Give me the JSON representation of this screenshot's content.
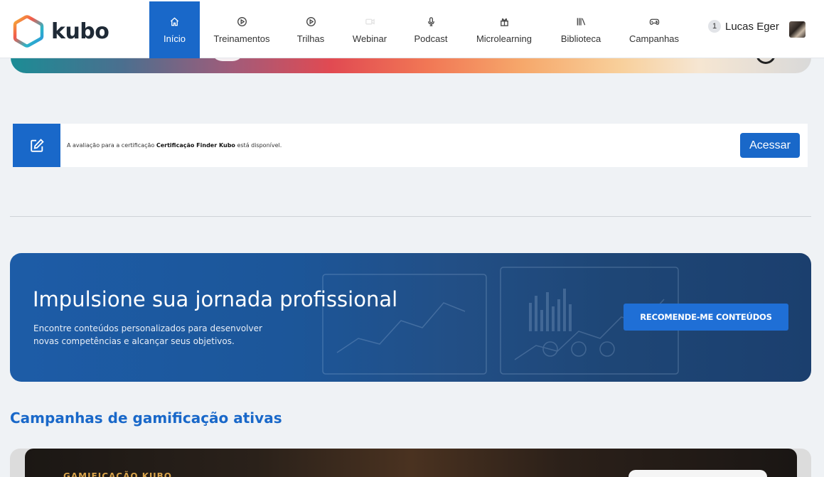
{
  "app": {
    "logo_text": "kubo",
    "accent": "#1968c9"
  },
  "nav": [
    {
      "label": "Início",
      "icon": "home-icon",
      "active": true
    },
    {
      "label": "Treinamentos",
      "icon": "play-circle-icon"
    },
    {
      "label": "Trilhas",
      "icon": "play-circle-icon"
    },
    {
      "label": "Webinar",
      "icon": "video-icon"
    },
    {
      "label": "Podcast",
      "icon": "microphone-icon"
    },
    {
      "label": "Microlearning",
      "icon": "gift-icon"
    },
    {
      "label": "Biblioteca",
      "icon": "books-icon"
    },
    {
      "label": "Campanhas",
      "icon": "gamepad-icon"
    }
  ],
  "user": {
    "notification_count": "1",
    "name": "Lucas Eger"
  },
  "notice": {
    "text_prefix": "A avaliação para a certificação ",
    "certification": "Certificação Finder Kubo",
    "text_suffix": " está disponível.",
    "button": "Acessar"
  },
  "hero": {
    "title": "Impulsione sua jornada profissional",
    "subtitle": "Encontre conteúdos personalizados para desenvolver novas competências e alcançar seus objetivos.",
    "button": "RECOMENDE-ME CONTEÚDOS"
  },
  "campaigns": {
    "section_title": "Campanhas de gamificação ativas",
    "card_label": "GAMIFICAÇÃO KUBO"
  }
}
